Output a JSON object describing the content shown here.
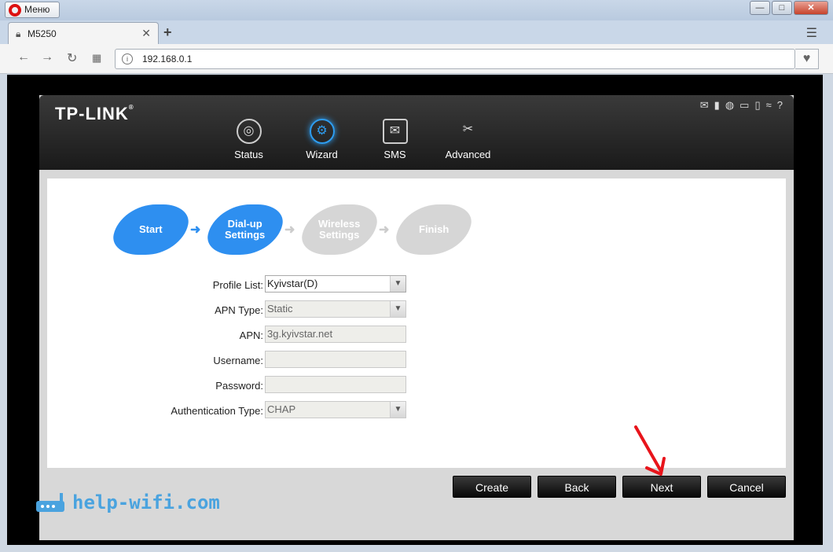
{
  "browser": {
    "menu_label": "Меню",
    "tab_title": "M5250",
    "address": "192.168.0.1",
    "win_minimize": "—",
    "win_maximize": "□",
    "win_close": "✕"
  },
  "header": {
    "logo": "TP-LINK",
    "logo_mark": "®",
    "nav": [
      {
        "label": "Status",
        "icon": "globe-icon"
      },
      {
        "label": "Wizard",
        "icon": "gear-icon"
      },
      {
        "label": "SMS",
        "icon": "envelope-icon"
      },
      {
        "label": "Advanced",
        "icon": "tools-icon"
      }
    ]
  },
  "steps": [
    {
      "label": "Start",
      "state": "done"
    },
    {
      "label": "Dial-up\nSettings",
      "state": "done"
    },
    {
      "label": "Wireless\nSettings",
      "state": "todo"
    },
    {
      "label": "Finish",
      "state": "todo"
    }
  ],
  "form": {
    "profile_list": {
      "label": "Profile List:",
      "value": "Kyivstar(D)"
    },
    "apn_type": {
      "label": "APN Type:",
      "value": "Static"
    },
    "apn": {
      "label": "APN:",
      "value": "3g.kyivstar.net"
    },
    "username": {
      "label": "Username:",
      "value": ""
    },
    "password": {
      "label": "Password:",
      "value": ""
    },
    "auth_type": {
      "label": "Authentication Type:",
      "value": "CHAP"
    }
  },
  "buttons": {
    "create": "Create",
    "back": "Back",
    "next": "Next",
    "cancel": "Cancel"
  },
  "watermark": "help-wifi.com",
  "colors": {
    "accent": "#2e8ff0",
    "inactive": "#d6d6d6",
    "watermark": "#4aa3df"
  }
}
